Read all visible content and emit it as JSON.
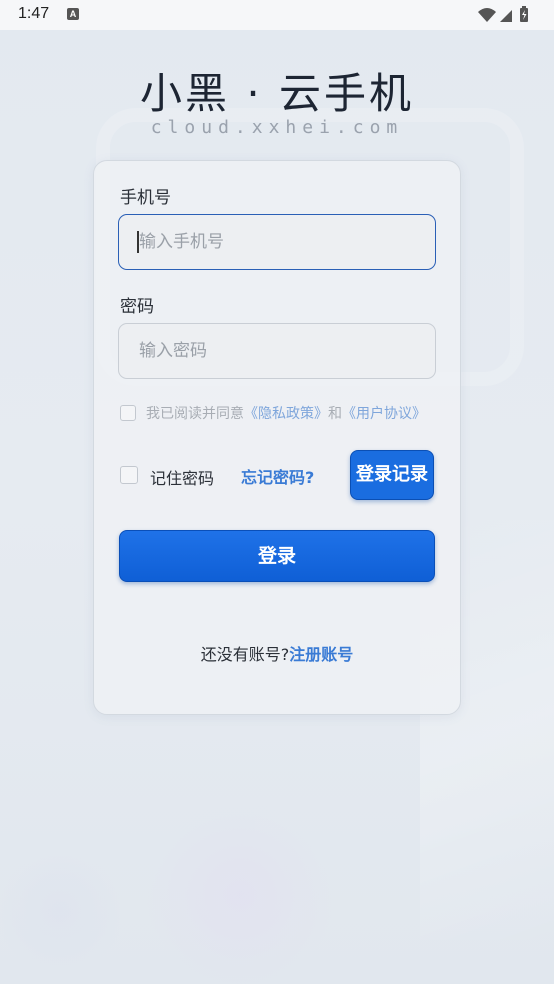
{
  "status_bar": {
    "time": "1:47",
    "notification_badge": "A"
  },
  "header": {
    "title": "小黑 · 云手机",
    "subtitle": "cloud.xxhei.com"
  },
  "form": {
    "phone_label": "手机号",
    "phone_placeholder": "输入手机号",
    "password_label": "密码",
    "password_placeholder": "输入密码",
    "agreement_prefix": "我已阅读并同意",
    "privacy_link": "《隐私政策》",
    "agreement_and": "和",
    "terms_link": "《用户协议》",
    "remember_label": "记住密码",
    "forgot_link": "忘记密码?",
    "login_record_button": "登录记录",
    "login_button": "登录",
    "register_prompt": "还没有账号?",
    "register_link": "注册账号"
  },
  "colors": {
    "accent": "#1a6de0",
    "link": "#3a7bd5"
  }
}
